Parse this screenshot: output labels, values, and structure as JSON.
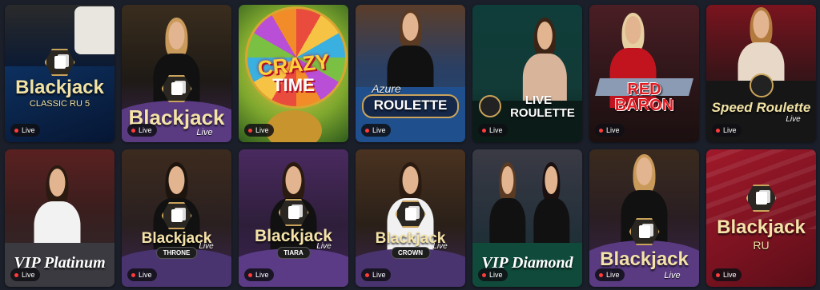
{
  "live_label": "Live",
  "games": [
    {
      "title": "Blackjack",
      "subtitle": "CLASSIC RU 5"
    },
    {
      "title": "Blackjack",
      "subtitle": "Live"
    },
    {
      "title": "CRAZY",
      "subtitle": "TIME"
    },
    {
      "title": "ROULETTE",
      "subtitle": "Azure"
    },
    {
      "title": "LIVE",
      "subtitle": "ROULETTE"
    },
    {
      "title": "RED",
      "subtitle": "BARON"
    },
    {
      "title": "Speed Roulette",
      "subtitle": "Live"
    },
    {
      "title": "VIP Platinum",
      "subtitle": ""
    },
    {
      "title": "Blackjack",
      "subtitle": "Live",
      "badge": "THRONE"
    },
    {
      "title": "Blackjack",
      "subtitle": "Live",
      "badge": "TIARA"
    },
    {
      "title": "Blackjack",
      "subtitle": "Live",
      "badge": "CROWN"
    },
    {
      "title": "VIP Diamond",
      "subtitle": ""
    },
    {
      "title": "Blackjack",
      "subtitle": "Live"
    },
    {
      "title": "Blackjack",
      "subtitle": "RU"
    }
  ]
}
